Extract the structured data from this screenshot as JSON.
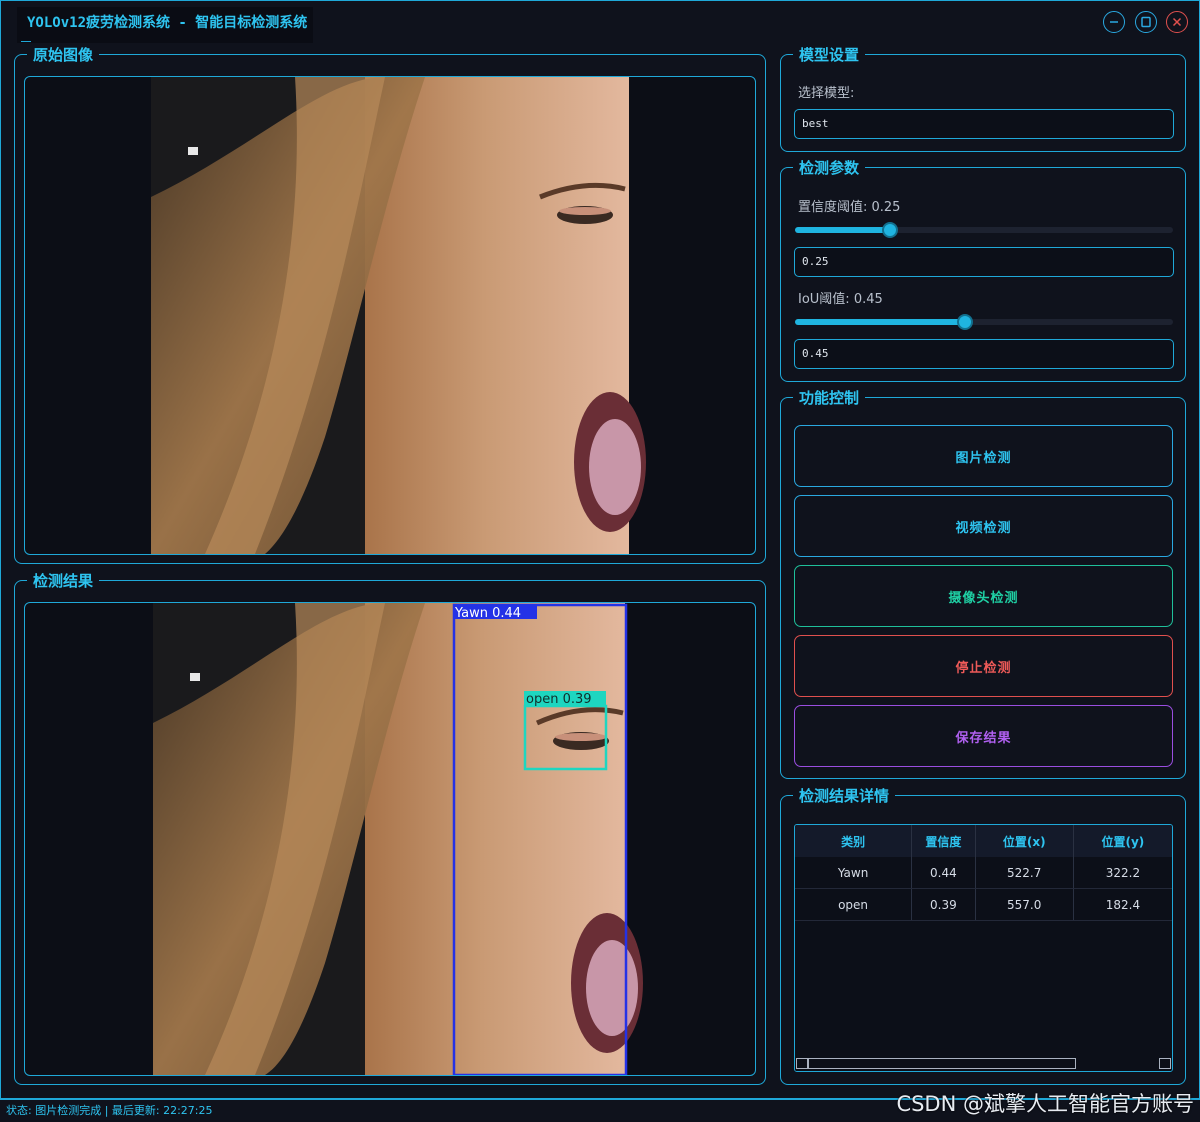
{
  "window": {
    "title": "YOLOv12疲劳检测系统 - 智能目标检测系统"
  },
  "panels": {
    "original": {
      "title": "原始图像"
    },
    "result": {
      "title": "检测结果"
    }
  },
  "detections_overlay": [
    {
      "label": "Yawn 0.44",
      "color": "#2432e6"
    },
    {
      "label": "open 0.39",
      "color": "#1ed6c0"
    }
  ],
  "model_settings": {
    "title": "模型设置",
    "select_label": "选择模型:",
    "selected_model": "best"
  },
  "detection_params": {
    "title": "检测参数",
    "confidence_label": "置信度阈值: 0.25",
    "confidence_value": "0.25",
    "confidence_level": 0.25,
    "iou_label": "IoU阈值: 0.45",
    "iou_value": "0.45",
    "iou_level": 0.45
  },
  "controls": {
    "title": "功能控制",
    "image_detect": "图片检测",
    "video_detect": "视频检测",
    "camera_detect": "摄像头检测",
    "stop_detect": "停止检测",
    "save_result": "保存结果",
    "colors": {
      "image": "#2aa8e0",
      "video": "#2aa8e0",
      "camera": "#1fbf9a",
      "stop": "#e0504e",
      "save": "#9a4ee0"
    }
  },
  "results_table": {
    "title": "检测结果详情",
    "headers": [
      "类别",
      "置信度",
      "位置(x)",
      "位置(y)"
    ],
    "rows": [
      [
        "Yawn",
        "0.44",
        "522.7",
        "322.2"
      ],
      [
        "open",
        "0.39",
        "557.0",
        "182.4"
      ]
    ]
  },
  "status": {
    "text": "状态: 图片检测完成 | 最后更新: 22:27:25"
  },
  "watermark": "CSDN @斌擎人工智能官方账号"
}
